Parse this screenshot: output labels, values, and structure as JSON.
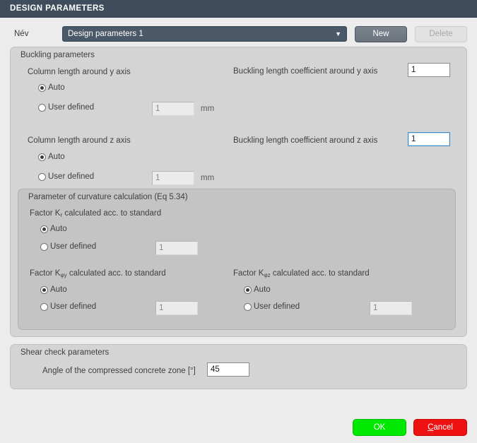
{
  "window": {
    "title": "DESIGN PARAMETERS"
  },
  "name_row": {
    "label": "Név",
    "combo_value": "Design parameters 1",
    "chevron_icon": "chevron-down-icon",
    "new_label": "New",
    "delete_label": "Delete"
  },
  "buckling": {
    "title": "Buckling parameters",
    "y": {
      "length_label": "Column length around y axis",
      "auto_label": "Auto",
      "user_label": "User defined",
      "user_value": "1",
      "unit": "mm",
      "coef_label": "Buckling length coefficient around y axis",
      "coef_value": "1"
    },
    "z": {
      "length_label": "Column length around z axis",
      "auto_label": "Auto",
      "user_label": "User defined",
      "user_value": "1",
      "unit": "mm",
      "coef_label": "Buckling length coefficient around z axis",
      "coef_value": "1"
    }
  },
  "curvature": {
    "title": "Parameter of curvature calculation (Eq 5.34)",
    "kr": {
      "label_prefix": "Factor K",
      "label_sub": "r",
      "label_suffix": " calculated acc. to standard",
      "auto_label": "Auto",
      "user_label": "User defined",
      "user_value": "1"
    },
    "kphiy": {
      "label_prefix": "Factor K",
      "label_sub": "φy",
      "label_suffix": " calculated acc. to standard",
      "auto_label": "Auto",
      "user_label": "User defined",
      "user_value": "1"
    },
    "kphiz": {
      "label_prefix": "Factor K",
      "label_sub": "φz",
      "label_suffix": " calculated acc. to standard",
      "auto_label": "Auto",
      "user_label": "User defined",
      "user_value": "1"
    }
  },
  "shear": {
    "title": "Shear check parameters",
    "angle_label": "Angle of the compressed concrete zone [°]",
    "angle_value": "45"
  },
  "footer": {
    "ok_label": "OK",
    "cancel_accel": "C",
    "cancel_rest": "ancel"
  },
  "colors": {
    "titlebar": "#3e4c5b",
    "combo": "#4a5868",
    "ok": "#00e800",
    "cancel": "#ee1111",
    "focus_border": "#3d8bc6"
  }
}
